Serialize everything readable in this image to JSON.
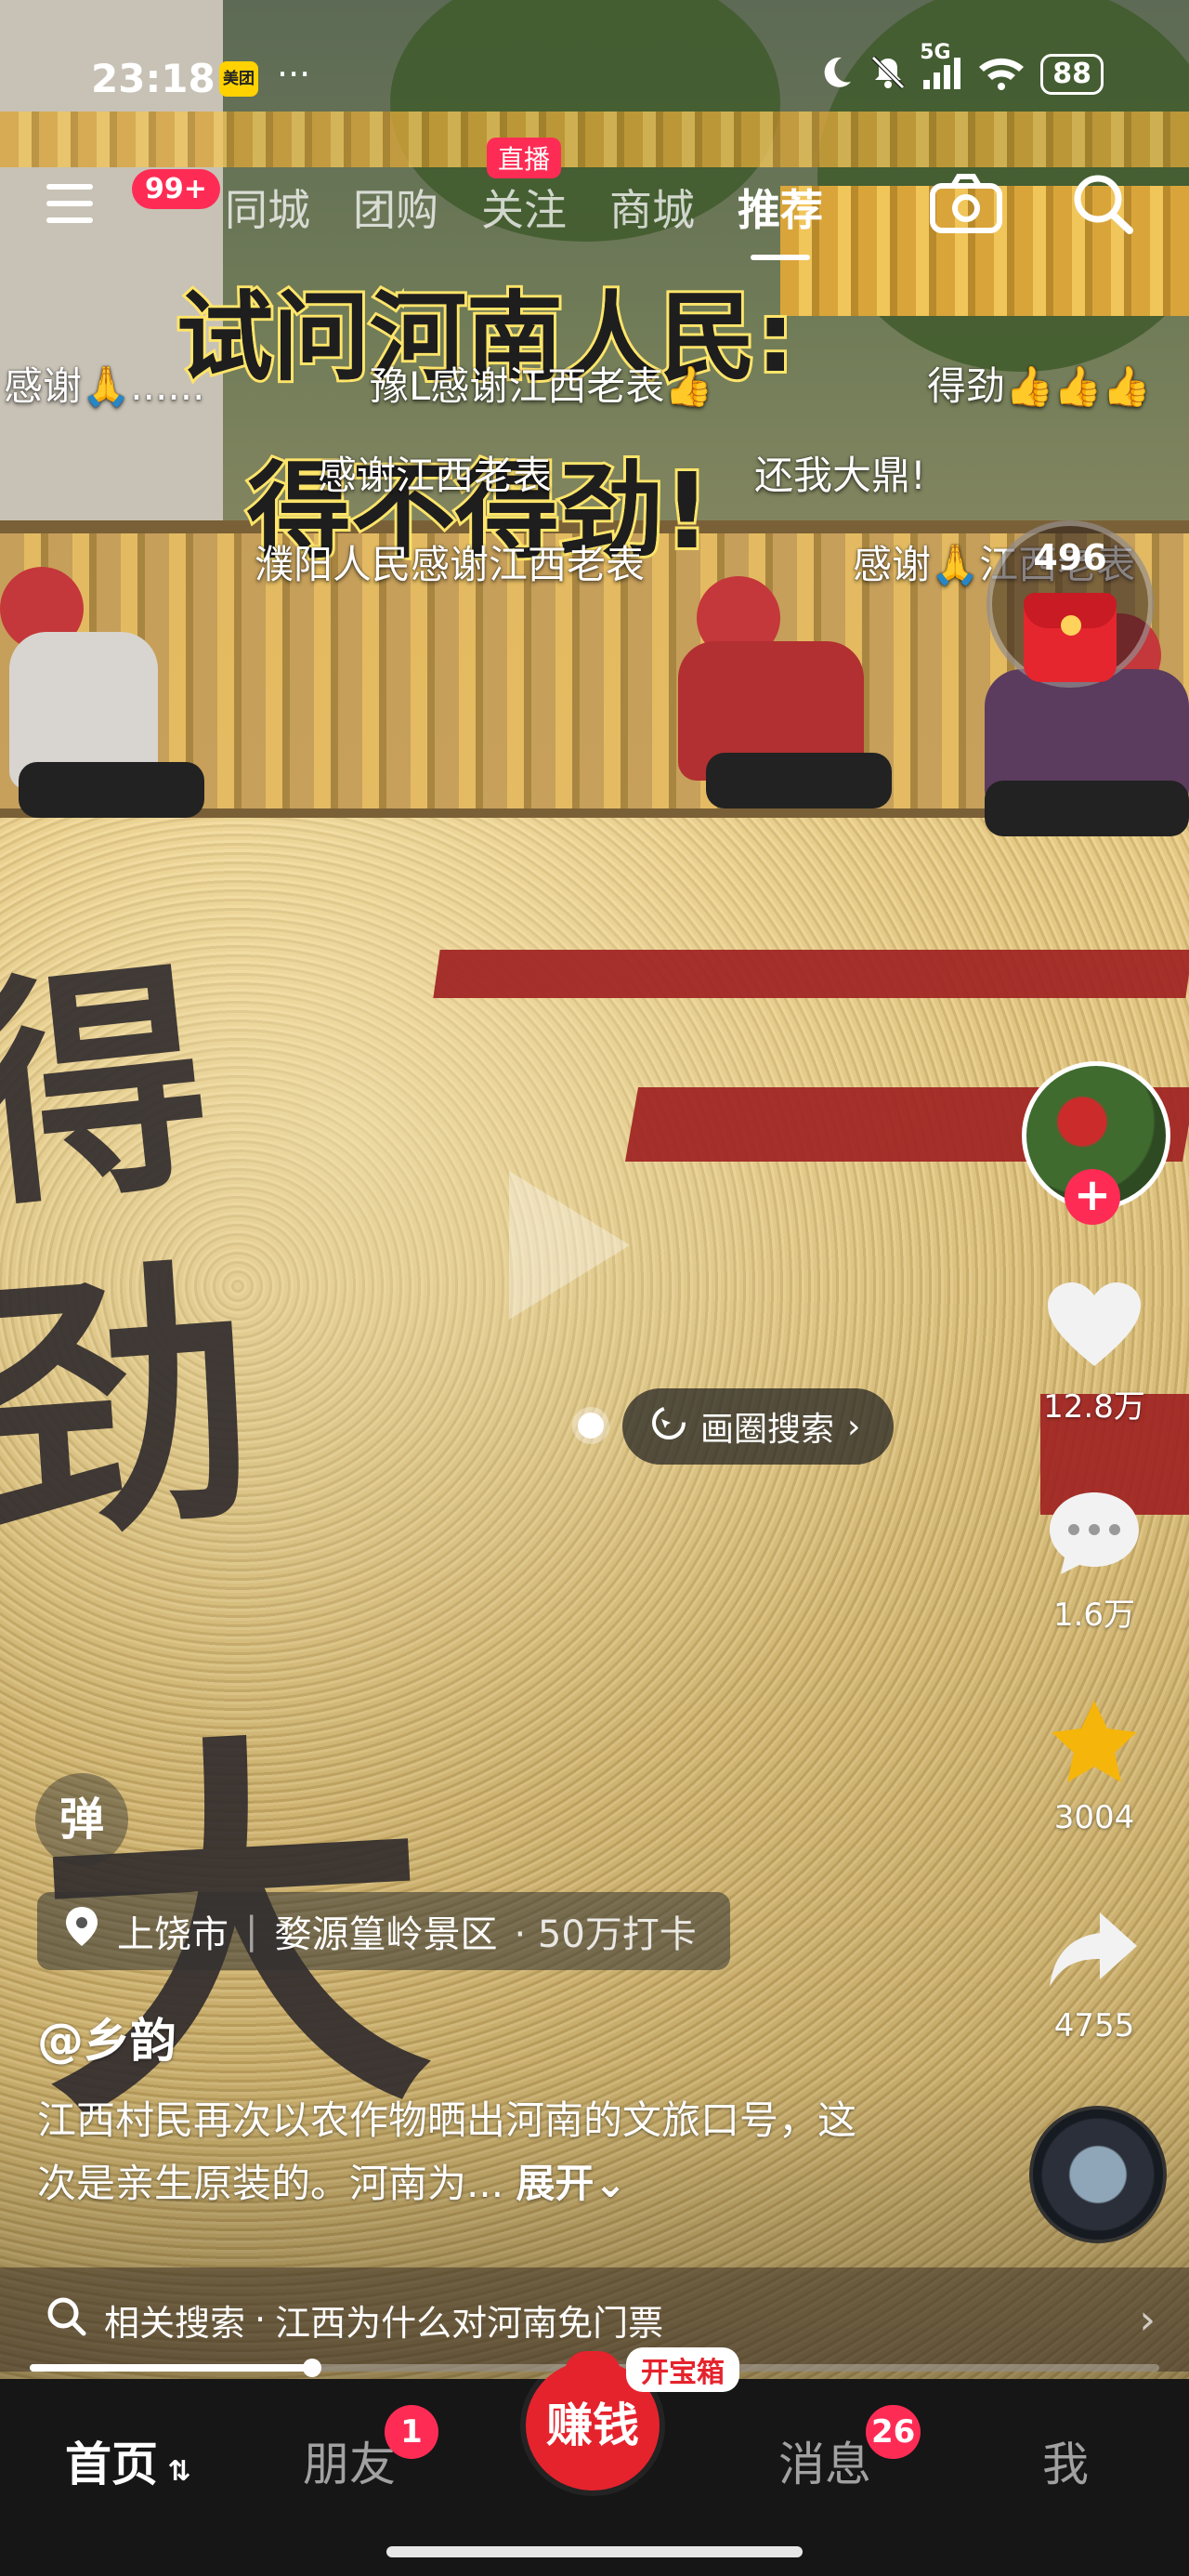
{
  "status_bar": {
    "time": "23:18",
    "meituan_label": "美团",
    "more_dots": "···",
    "network": "5G",
    "battery": "88"
  },
  "top_nav": {
    "menu_badge": "99+",
    "tabs": [
      {
        "label": "同城"
      },
      {
        "label": "团购"
      },
      {
        "label": "关注",
        "badge": "直播"
      },
      {
        "label": "商城"
      },
      {
        "label": "推荐",
        "active": true
      }
    ]
  },
  "video_overlay": {
    "title_line1": "试问河南人民:",
    "title_line2": "得不得劲!",
    "danmaku": [
      "感谢🙏......",
      "豫L感谢江西老表👍",
      "得劲👍👍👍",
      "感谢江西老表",
      "还我大鼎!",
      "濮阳人民感谢江西老表",
      "感谢🙏江西老表"
    ]
  },
  "red_packet": {
    "count": "496"
  },
  "circle_search": {
    "label": "画圈搜索"
  },
  "right_rail": {
    "likes": "12.8万",
    "comments": "1.6万",
    "favorites": "3004",
    "shares": "4755"
  },
  "danmu_toggle": {
    "label": "弹"
  },
  "location": {
    "city": "上饶市",
    "place": "婺源篁岭景区",
    "checkins": "· 50万打卡"
  },
  "post": {
    "author": "@乡韵",
    "description": "江西村民再次以农作物晒出河南的文旅口号，这次是亲生原装的。河南为...",
    "expand_label": "展开"
  },
  "related_search": {
    "prefix": "相关搜索",
    "dot": "·",
    "query": "江西为什么对河南免门票"
  },
  "playback": {
    "progress_fraction": 0.25
  },
  "bottom_tabs": {
    "home": "首页",
    "friends": "朋友",
    "friends_badge": "1",
    "earn": "赚钱",
    "earn_tag": "开宝箱",
    "messages": "消息",
    "messages_badge": "26",
    "me": "我"
  },
  "colors": {
    "accent": "#fe2c55",
    "earn_red": "#e5232d",
    "title_yellow": "#ffe56a"
  }
}
